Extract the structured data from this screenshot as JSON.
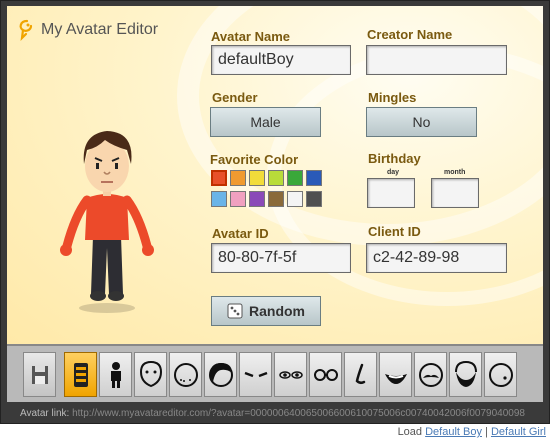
{
  "app": {
    "title": "My Avatar Editor"
  },
  "fields": {
    "avatar_name": {
      "label": "Avatar Name",
      "value": "defaultBoy"
    },
    "creator_name": {
      "label": "Creator Name",
      "value": ""
    },
    "gender": {
      "label": "Gender",
      "value": "Male"
    },
    "mingles": {
      "label": "Mingles",
      "value": "No"
    },
    "favorite_color": {
      "label": "Favorite Color",
      "colors": [
        "#e8502a",
        "#f09a30",
        "#f2dc3a",
        "#b8dc3a",
        "#3aa83a",
        "#2a5ab8",
        "#6ab4e8",
        "#f0a0c0",
        "#8a4ab8",
        "#8a6a3a",
        "#f4f4f4",
        "#505050"
      ],
      "selected_index": 0
    },
    "birthday": {
      "label": "Birthday",
      "day_label": "day",
      "month_label": "month",
      "day": "",
      "month": ""
    },
    "avatar_id": {
      "label": "Avatar ID",
      "value": "80-80-7f-5f"
    },
    "client_id": {
      "label": "Client ID",
      "value": "c2-42-89-98"
    }
  },
  "random_button": {
    "label": "Random",
    "icon": "dice-icon"
  },
  "toolbar": {
    "tools": [
      {
        "name": "save-icon"
      },
      {
        "name": "body-shape-icon"
      },
      {
        "name": "body-icon"
      },
      {
        "name": "face-shape-icon"
      },
      {
        "name": "face-features-icon"
      },
      {
        "name": "hair-icon"
      },
      {
        "name": "eyebrows-icon"
      },
      {
        "name": "eyes-icon"
      },
      {
        "name": "glasses-icon"
      },
      {
        "name": "nose-icon"
      },
      {
        "name": "mouth-icon"
      },
      {
        "name": "mustache-icon"
      },
      {
        "name": "beard-icon"
      },
      {
        "name": "mole-icon"
      }
    ],
    "active_index": 1
  },
  "link_bar": {
    "label": "Avatar link:",
    "url": "http://www.myavatareditor.com/?avatar=000000640065006600610075006c00740042006f0079040098"
  },
  "footer": {
    "prefix": "Load",
    "link_boy": "Default Boy",
    "separator": "|",
    "link_girl": "Default Girl"
  },
  "colors": {
    "accent": "#f0a400",
    "label": "#7a5a10",
    "panel": "#fff4cc"
  }
}
